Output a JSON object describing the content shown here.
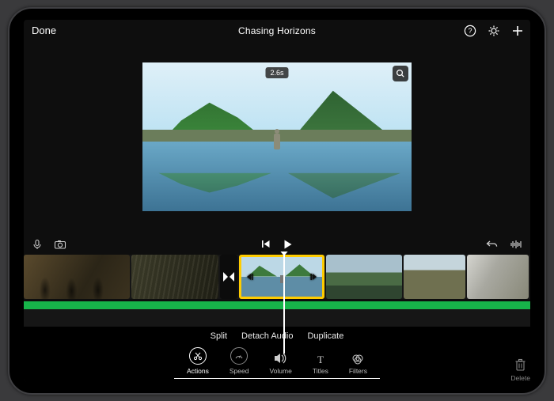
{
  "header": {
    "done_label": "Done",
    "title": "Chasing Horizons",
    "icons": {
      "help": "help-icon",
      "settings": "gear-icon",
      "add": "plus-icon"
    }
  },
  "preview": {
    "time_badge": "2.6s",
    "zoom_icon": "magnifier-icon"
  },
  "controls": {
    "left": {
      "mic": "microphone-icon",
      "camera": "camera-icon"
    },
    "center": {
      "prev": "skip-back-icon",
      "play": "play-icon"
    },
    "right": {
      "undo": "undo-icon",
      "waveform": "waveform-icon"
    }
  },
  "timeline": {
    "transition_icon": "transition-icon",
    "selected_clip_handles": {
      "left": "trim-left-icon",
      "right": "trim-right-icon"
    },
    "playhead": "playhead"
  },
  "clip_actions": {
    "text": {
      "split": "Split",
      "detach": "Detach Audio",
      "duplicate": "Duplicate"
    },
    "tabs": [
      {
        "key": "actions",
        "label": "Actions",
        "icon": "scissors-icon",
        "active": true
      },
      {
        "key": "speed",
        "label": "Speed",
        "icon": "speedometer-icon",
        "active": false
      },
      {
        "key": "volume",
        "label": "Volume",
        "icon": "speaker-icon",
        "active": false
      },
      {
        "key": "titles",
        "label": "Titles",
        "icon": "titles-icon",
        "active": false
      },
      {
        "key": "filters",
        "label": "Filters",
        "icon": "filters-icon",
        "active": false
      }
    ]
  },
  "footer": {
    "delete_label": "Delete",
    "delete_icon": "trash-icon"
  }
}
